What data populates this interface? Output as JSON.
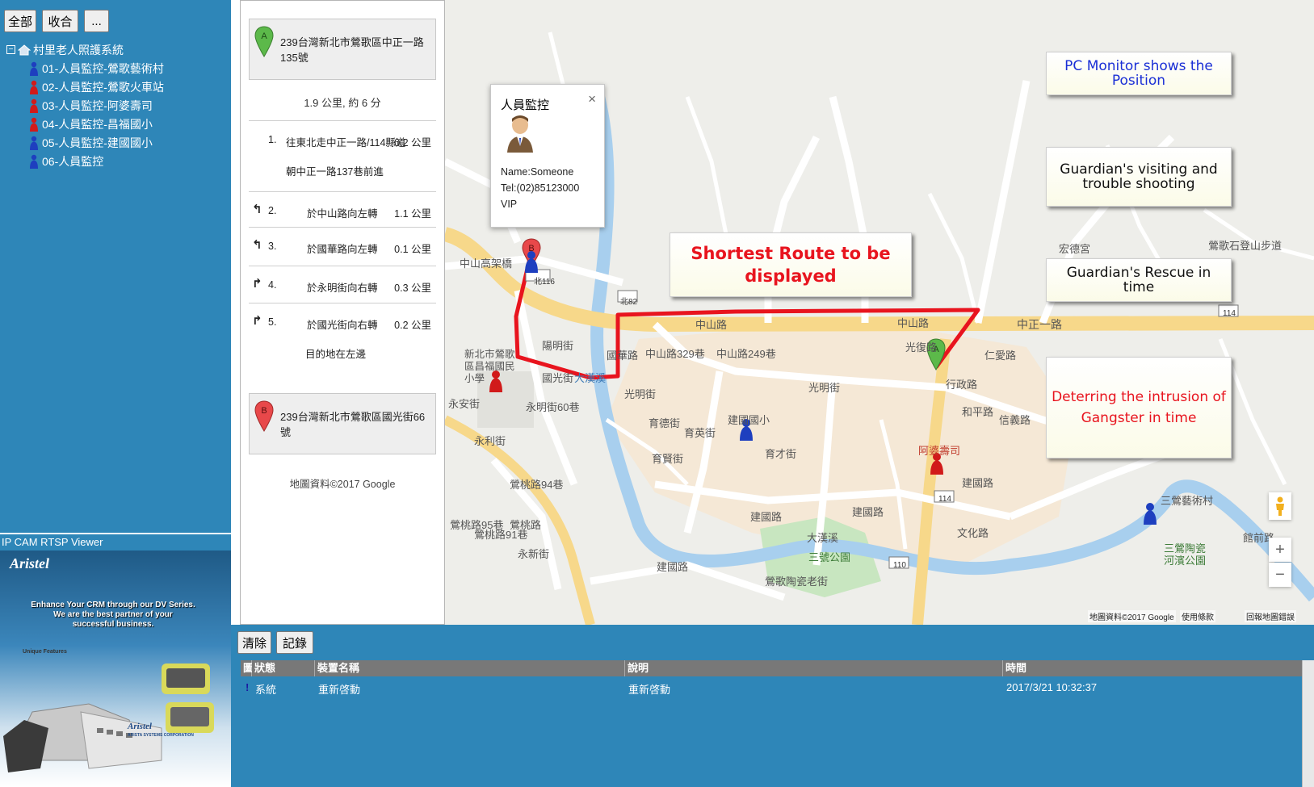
{
  "toolbar": {
    "all_label": "全部",
    "collapse_label": "收合",
    "more_label": "..."
  },
  "tree": {
    "root_label": "村里老人照護系統",
    "items": [
      {
        "label": "01-人員監控-鶯歌藝術村",
        "color": "#1e3fbf"
      },
      {
        "label": "02-人員監控-鶯歌火車站",
        "color": "#d11a1a"
      },
      {
        "label": "03-人員監控-阿婆壽司",
        "color": "#d11a1a"
      },
      {
        "label": "04-人員監控-昌福國小",
        "color": "#d11a1a"
      },
      {
        "label": "05-人員監控-建國國小",
        "color": "#1e3fbf"
      },
      {
        "label": "06-人員監控",
        "color": "#1e3fbf"
      }
    ]
  },
  "camera": {
    "title": "IP CAM RTSP Viewer",
    "brand": "Aristel",
    "tagline_1": "Enhance Your CRM through our DV Series.",
    "tagline_2": "We are the best partner of your",
    "tagline_3": "successful business.",
    "features_heading": "Unique Features",
    "company": "ARISTA SYSTEMS CORPORATION"
  },
  "directions": {
    "origin_marker": "A",
    "origin_address": "239台灣新北市鶯歌區中正一路135號",
    "summary": "1.9 公里, 約 6 分",
    "steps": [
      {
        "num": "1.",
        "text": "往東北走中正一路/114縣道",
        "text2": "朝中正一路137巷前進",
        "dist": "0.2 公里",
        "turn": ""
      },
      {
        "num": "2.",
        "text": "於中山路向左轉",
        "dist": "1.1 公里",
        "turn": "↰"
      },
      {
        "num": "3.",
        "text": "於國華路向左轉",
        "dist": "0.1 公里",
        "turn": "↰"
      },
      {
        "num": "4.",
        "text": "於永明街向右轉",
        "dist": "0.3 公里",
        "turn": "↱"
      },
      {
        "num": "5.",
        "text": "於國光街向右轉",
        "text2": "目的地在左邊",
        "dist": "0.2 公里",
        "turn": "↱"
      }
    ],
    "dest_marker": "B",
    "dest_address": "239台灣新北市鶯歌區國光街66號",
    "copyright": "地圖資料©2017 Google"
  },
  "popup": {
    "title": "人員監控",
    "close": "×",
    "name": "Name:Someone",
    "tel": "Tel:(02)85123000",
    "level": "VIP"
  },
  "overlays": {
    "route": "Shortest Route to be displayed",
    "pc_monitor": "PC Monitor shows the Position",
    "visiting": "Guardian's visiting and trouble shooting",
    "rescue": "Guardian's Rescue in time",
    "deterring": "Deterring the intrusion of Gangster in time",
    "accent_red": "#e8141e",
    "accent_blue": "#1a2fd6"
  },
  "map": {
    "labels": {
      "zhongshan_road_1": "中山路",
      "zhongshan_road_2": "中山路",
      "zhongzheng_road": "中正一路",
      "zhongshan_329": "中山路329巷",
      "zhongshan_249": "中山路249巷",
      "guangming_st_1": "光明街",
      "guangming_st_2": "光明街",
      "yuying_st": "育英街",
      "yude_st": "育德街",
      "yuxian_st": "育賢街",
      "jianguo_school": "建國國小",
      "yucai_st": "育才街",
      "xingzheng_road": "行政路",
      "jianguo_road_1": "建國路",
      "jianguo_road_2": "建國路",
      "jianguo_road_3": "建國路",
      "jianguo_road_4": "建國路",
      "wenhua_road": "文化路",
      "dahan_river_1": "大漢溪",
      "dahan_river_2": "大漢溪",
      "sanhao_park": "三號公園",
      "ceramics_st": "鶯歌陶瓷老街",
      "changfu_school": "新北市鶯歌區昌福國民小學",
      "yangming_st": "陽明街",
      "guangming_st_3": "國光街",
      "yingtao_road": "鶯桃路",
      "yingtao_94": "鶯桃路94巷",
      "yingtao_95": "鶯桃路95巷",
      "yingtao_91": "鶯桃路91巷",
      "yongming_60": "永明街60巷",
      "yongli_st": "永利街",
      "yongan_st": "永安街",
      "yonghe_st": "永新街",
      "zhongshan_viaduct": "中山高架橋",
      "hongde_temple": "宏德宮",
      "shidenshan_trail": "鶯歌石登山步道",
      "asan_sushi": "阿婆壽司",
      "art_village": "三鶯藝術村",
      "riverside_park": "三鶯陶瓷河濱公園",
      "guangfu_road": "光復路",
      "fuhua_st": "國華路",
      "renai_road": "仁愛路",
      "xinyi_road": "信義路",
      "heping_road": "和平路",
      "guanqian_road": "館前路",
      "road_114": "114",
      "road_114b": "114",
      "road_110": "110",
      "road_116": "北116",
      "road_82": "北82",
      "copyright": "地圖資料©2017 Google",
      "terms": "使用條款",
      "report": "回報地圖錯誤"
    },
    "zoom_in": "+",
    "zoom_out": "−",
    "route_color": "#e8141e"
  },
  "log": {
    "clear_label": "清除",
    "record_label": "記錄",
    "columns": [
      "圖",
      "狀態",
      "裝置名稱",
      "說明",
      "時間"
    ],
    "rows": [
      {
        "icon": "!",
        "status": "系統",
        "device": "重新啓動",
        "desc": "重新啓動",
        "time": "2017/3/21 10:32:37"
      }
    ]
  }
}
